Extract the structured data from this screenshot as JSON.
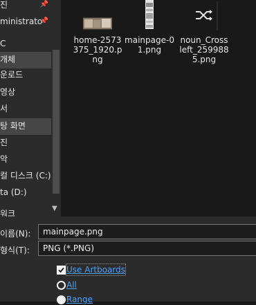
{
  "sidebar": {
    "items": [
      {
        "label": "진",
        "pinned": true
      },
      {
        "label": "ministrato",
        "pinned": true
      },
      {
        "label": "C",
        "pinned": false
      },
      {
        "label": "개체",
        "pinned": false
      },
      {
        "label": "운로드",
        "pinned": false
      },
      {
        "label": "영상",
        "pinned": false
      },
      {
        "label": "서",
        "pinned": false
      },
      {
        "label": "탕 화면",
        "pinned": false
      },
      {
        "label": "진",
        "pinned": false
      },
      {
        "label": "악",
        "pinned": false
      },
      {
        "label": "컬 디스크 (C:)",
        "pinned": false
      },
      {
        "label": "ta (D:)",
        "pinned": false
      },
      {
        "label": "워크",
        "pinned": false
      }
    ],
    "pin_glyph": "📌",
    "scroll_down_glyph": "▼"
  },
  "files": [
    {
      "name": "home-2573375_1920.png",
      "icon": "image-thumbnail-icon"
    },
    {
      "name": "mainpage-01.png",
      "icon": "image-thumbnail-icon"
    },
    {
      "name": "noun_Cross left_2599885.png",
      "icon": "shuffle-icon"
    }
  ],
  "save": {
    "filename_label": "이름(N):",
    "filename_value": "mainpage.png",
    "filetype_label": "형식(T):",
    "filetype_value": "PNG (*.PNG)"
  },
  "options": {
    "use_artboards": "Use Artboards",
    "use_artboards_checked": true,
    "all": "All",
    "all_selected": true,
    "range": "Range"
  }
}
